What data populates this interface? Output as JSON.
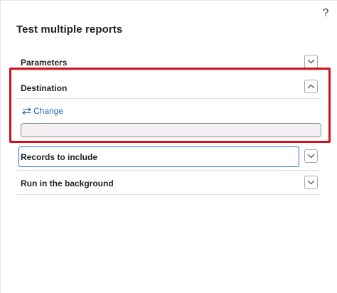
{
  "dialog": {
    "title": "Test multiple reports",
    "help_glyph": "?"
  },
  "sections": {
    "parameters": {
      "label": "Parameters",
      "expanded": false
    },
    "destination": {
      "label": "Destination",
      "expanded": true,
      "change_label": "Change",
      "destination_value": ""
    },
    "records": {
      "label": "Records to include",
      "expanded": false
    },
    "background": {
      "label": "Run in the background",
      "expanded": false
    }
  },
  "colors": {
    "highlight": "#d40f1a",
    "link": "#2267b8",
    "focus": "#2a6cc4"
  },
  "icons": {
    "help": "help-icon",
    "expand": "chevron-down-icon",
    "collapse": "chevron-up-icon",
    "change": "swap-arrows-icon"
  }
}
